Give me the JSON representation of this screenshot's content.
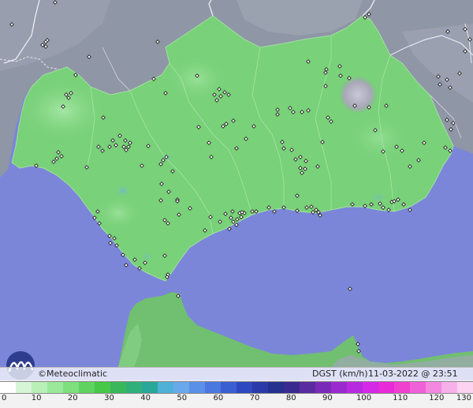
{
  "map": {
    "credit_text": "©Meteoclimatic",
    "variable_label": "DGST (km/h)",
    "timestamp": "11-03-2022 @ 23:51 UTC"
  },
  "legend": {
    "tick_labels": [
      "0",
      "10",
      "20",
      "30",
      "40",
      "50",
      "60",
      "70",
      "80",
      "90",
      "100",
      "110",
      "120",
      "130"
    ],
    "colors": [
      "#ffffff",
      "#d6f5d6",
      "#b8f0b8",
      "#9ae89a",
      "#7de07d",
      "#5fd35f",
      "#48c848",
      "#38b85a",
      "#2fb07a",
      "#27a898",
      "#4fb0d8",
      "#6aa8ec",
      "#5a90e8",
      "#4a78e0",
      "#3a5fd0",
      "#2e48c0",
      "#2a3aa8",
      "#26308f",
      "#3a2a8f",
      "#5a2aa0",
      "#7a2ab8",
      "#9a2ad0",
      "#b82ae0",
      "#d42ae8",
      "#e82ad8",
      "#f040d0",
      "#f060d8",
      "#f488e0",
      "#f8b0ea",
      "#fcd4f2"
    ]
  },
  "stations": [
    [
      70,
      3
    ],
    [
      15,
      31
    ],
    [
      60,
      51
    ],
    [
      58,
      53
    ],
    [
      54,
      57
    ],
    [
      58,
      59
    ],
    [
      113,
      72
    ],
    [
      96,
      95
    ],
    [
      200,
      53
    ],
    [
      195,
      100
    ],
    [
      210,
      118
    ],
    [
      250,
      96
    ],
    [
      272,
      120
    ],
    [
      275,
      127
    ],
    [
      280,
      122
    ],
    [
      285,
      117
    ],
    [
      290,
      120
    ],
    [
      278,
      113
    ],
    [
      84,
      120
    ],
    [
      90,
      118
    ],
    [
      87,
      124
    ],
    [
      80,
      135
    ],
    [
      131,
      149
    ],
    [
      152,
      172
    ],
    [
      147,
      184
    ],
    [
      157,
      186
    ],
    [
      163,
      186
    ],
    [
      160,
      190
    ],
    [
      143,
      178
    ],
    [
      139,
      186
    ],
    [
      159,
      178
    ],
    [
      165,
      181
    ],
    [
      130,
      191
    ],
    [
      125,
      186
    ],
    [
      188,
      185
    ],
    [
      74,
      193
    ],
    [
      78,
      198
    ],
    [
      72,
      201
    ],
    [
      68,
      205
    ],
    [
      46,
      210
    ],
    [
      110,
      212
    ],
    [
      180,
      210
    ],
    [
      207,
      203
    ],
    [
      211,
      199
    ],
    [
      204,
      208
    ],
    [
      265,
      181
    ],
    [
      268,
      199
    ],
    [
      296,
      153
    ],
    [
      283,
      160
    ],
    [
      287,
      157
    ],
    [
      252,
      161
    ],
    [
      300,
      188
    ],
    [
      312,
      176
    ],
    [
      322,
      160
    ],
    [
      352,
      139
    ],
    [
      352,
      145
    ],
    [
      368,
      137
    ],
    [
      372,
      142
    ],
    [
      383,
      142
    ],
    [
      391,
      140
    ],
    [
      358,
      180
    ],
    [
      360,
      188
    ],
    [
      370,
      190
    ],
    [
      375,
      202
    ],
    [
      381,
      199
    ],
    [
      388,
      204
    ],
    [
      387,
      214
    ],
    [
      381,
      213
    ],
    [
      383,
      219
    ],
    [
      403,
      211
    ],
    [
      409,
      180
    ],
    [
      416,
      149
    ],
    [
      420,
      154
    ],
    [
      413,
      109
    ],
    [
      413,
      92
    ],
    [
      414,
      88
    ],
    [
      391,
      78
    ],
    [
      431,
      84
    ],
    [
      432,
      96
    ],
    [
      443,
      99
    ],
    [
      450,
      134
    ],
    [
      490,
      134
    ],
    [
      468,
      136
    ],
    [
      476,
      165
    ],
    [
      486,
      192
    ],
    [
      503,
      186
    ],
    [
      510,
      191
    ],
    [
      520,
      211
    ],
    [
      531,
      203
    ],
    [
      538,
      181
    ],
    [
      565,
      187
    ],
    [
      571,
      191
    ],
    [
      572,
      164
    ],
    [
      575,
      156
    ],
    [
      567,
      152
    ],
    [
      583,
      93
    ],
    [
      556,
      97
    ],
    [
      558,
      107
    ],
    [
      567,
      101
    ],
    [
      571,
      111
    ],
    [
      568,
      40
    ],
    [
      590,
      37
    ],
    [
      596,
      50
    ],
    [
      590,
      65
    ],
    [
      468,
      18
    ],
    [
      463,
      22
    ],
    [
      219,
      217
    ],
    [
      214,
      243
    ],
    [
      205,
      233
    ],
    [
      204,
      254
    ],
    [
      225,
      253
    ],
    [
      225,
      255
    ],
    [
      241,
      264
    ],
    [
      227,
      272
    ],
    [
      209,
      279
    ],
    [
      213,
      283
    ],
    [
      124,
      268
    ],
    [
      120,
      276
    ],
    [
      126,
      283
    ],
    [
      139,
      299
    ],
    [
      140,
      308
    ],
    [
      145,
      302
    ],
    [
      148,
      311
    ],
    [
      156,
      323
    ],
    [
      160,
      336
    ],
    [
      177,
      340
    ],
    [
      184,
      333
    ],
    [
      171,
      329
    ],
    [
      209,
      324
    ],
    [
      213,
      348
    ],
    [
      212,
      351
    ],
    [
      260,
      292
    ],
    [
      267,
      275
    ],
    [
      279,
      281
    ],
    [
      286,
      271
    ],
    [
      291,
      290
    ],
    [
      295,
      268
    ],
    [
      296,
      281
    ],
    [
      293,
      276
    ],
    [
      301,
      278
    ],
    [
      304,
      270
    ],
    [
      310,
      270
    ],
    [
      300,
      285
    ],
    [
      306,
      275
    ],
    [
      307,
      269
    ],
    [
      320,
      268
    ],
    [
      325,
      268
    ],
    [
      341,
      263
    ],
    [
      348,
      268
    ],
    [
      360,
      263
    ],
    [
      377,
      267
    ],
    [
      389,
      263
    ],
    [
      401,
      266
    ],
    [
      406,
      273
    ],
    [
      397,
      269
    ],
    [
      404,
      269
    ],
    [
      447,
      259
    ],
    [
      463,
      261
    ],
    [
      471,
      259
    ],
    [
      486,
      263
    ],
    [
      493,
      266
    ],
    [
      497,
      256
    ],
    [
      500,
      255
    ],
    [
      505,
      253
    ],
    [
      512,
      259
    ],
    [
      520,
      266
    ],
    [
      226,
      375
    ],
    [
      444,
      366
    ],
    [
      455,
      445
    ],
    [
      454,
      436
    ],
    [
      482,
      258
    ],
    [
      377,
      248
    ],
    [
      395,
      262
    ]
  ]
}
